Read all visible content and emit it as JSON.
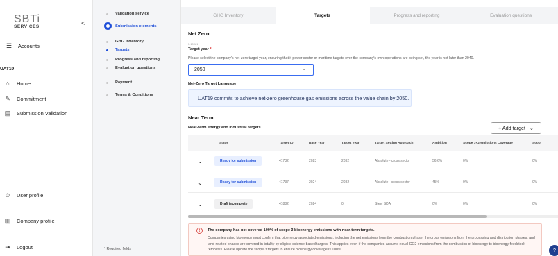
{
  "logo": {
    "big": "SBTi",
    "small": "SERVICES"
  },
  "collapse_glyph": "<",
  "organization": "UAT19",
  "nav": {
    "accounts": "Accounts",
    "home": "Home",
    "commitment": "Commitment",
    "submission_validation": "Submission Validation",
    "user_profile": "User profile",
    "company_profile": "Company profile",
    "logout": "Logout"
  },
  "steps": {
    "validation_service": "Validation service",
    "submission_elements": "Submission elements",
    "ghg_inventory": "GHG Inventory",
    "targets": "Targets",
    "progress_reporting": "Progress and reporting",
    "evaluation_questions": "Evaluation questions",
    "payment": "Payment",
    "terms": "Terms & Conditions",
    "required_note": "* Required fields"
  },
  "tabs": [
    "GHG Inventory",
    "Targets",
    "Progress and reporting",
    "Evaluation questions"
  ],
  "active_tab": 1,
  "net_zero": {
    "heading": "Net Zero",
    "ref": "5.10.1.1",
    "target_year_label": "Target year",
    "required_mark": "*",
    "hint": "Please select the company's net-zero target year, ensuring that if power sector or maritime targets over the company's own operations are being set, the year is not later than 2040.",
    "target_year_value": "2050",
    "language_label": "Net-Zero Target Language",
    "language_text": "UAT19 commits to achieve net-zero greenhouse gas emissions across the value chain by 2050."
  },
  "near_term": {
    "heading": "Near Term",
    "subheading": "Near-term energy and industrial targets",
    "add_button": "+ Add target",
    "columns": [
      "Stage",
      "Target ID",
      "Base Year",
      "Target Year",
      "Target Setting Approach",
      "Ambition",
      "Scope 1+2 emissions Coverage",
      "Scop"
    ],
    "rows": [
      {
        "stage": "Ready for submission",
        "stage_kind": "ready",
        "id": "41732",
        "base": "2023",
        "target": "2032",
        "approach": "Absolute - cross sector",
        "ambition": "56.6%",
        "coverage": "0%",
        "scope3": "0%"
      },
      {
        "stage": "Ready for submission",
        "stage_kind": "ready",
        "id": "41737",
        "base": "2024",
        "target": "2032",
        "approach": "Absolute - cross sector",
        "ambition": "45%",
        "coverage": "0%",
        "scope3": "0%"
      },
      {
        "stage": "Draft incomplete",
        "stage_kind": "draft",
        "id": "41882",
        "base": "2024",
        "target": "0",
        "approach": "Steel SDA",
        "ambition": "0%",
        "coverage": "0%",
        "scope3": "0%"
      }
    ]
  },
  "warning": {
    "title": "The company has not covered 100% of scope 3 bioenergy emissions with near-term targets.",
    "body": "Companies using bioenergy must confirm that bioenergy associated emissions, including the net emissions from the combustion phase, the gross emissions from the processing and distribution phases, and land-related phases are covered in totality by eligible science-based targets. This applies even if the companies assume equal CO2 emissions from the combustion of bioenergy to bioenergy feedstock removals. Please update the scope 3 targets to ensure bioenergy coverage is 100%."
  },
  "colors": {
    "accent": "#1f4fd8",
    "warning_border": "#f3c9c1",
    "warning_icon": "#d9534f"
  }
}
